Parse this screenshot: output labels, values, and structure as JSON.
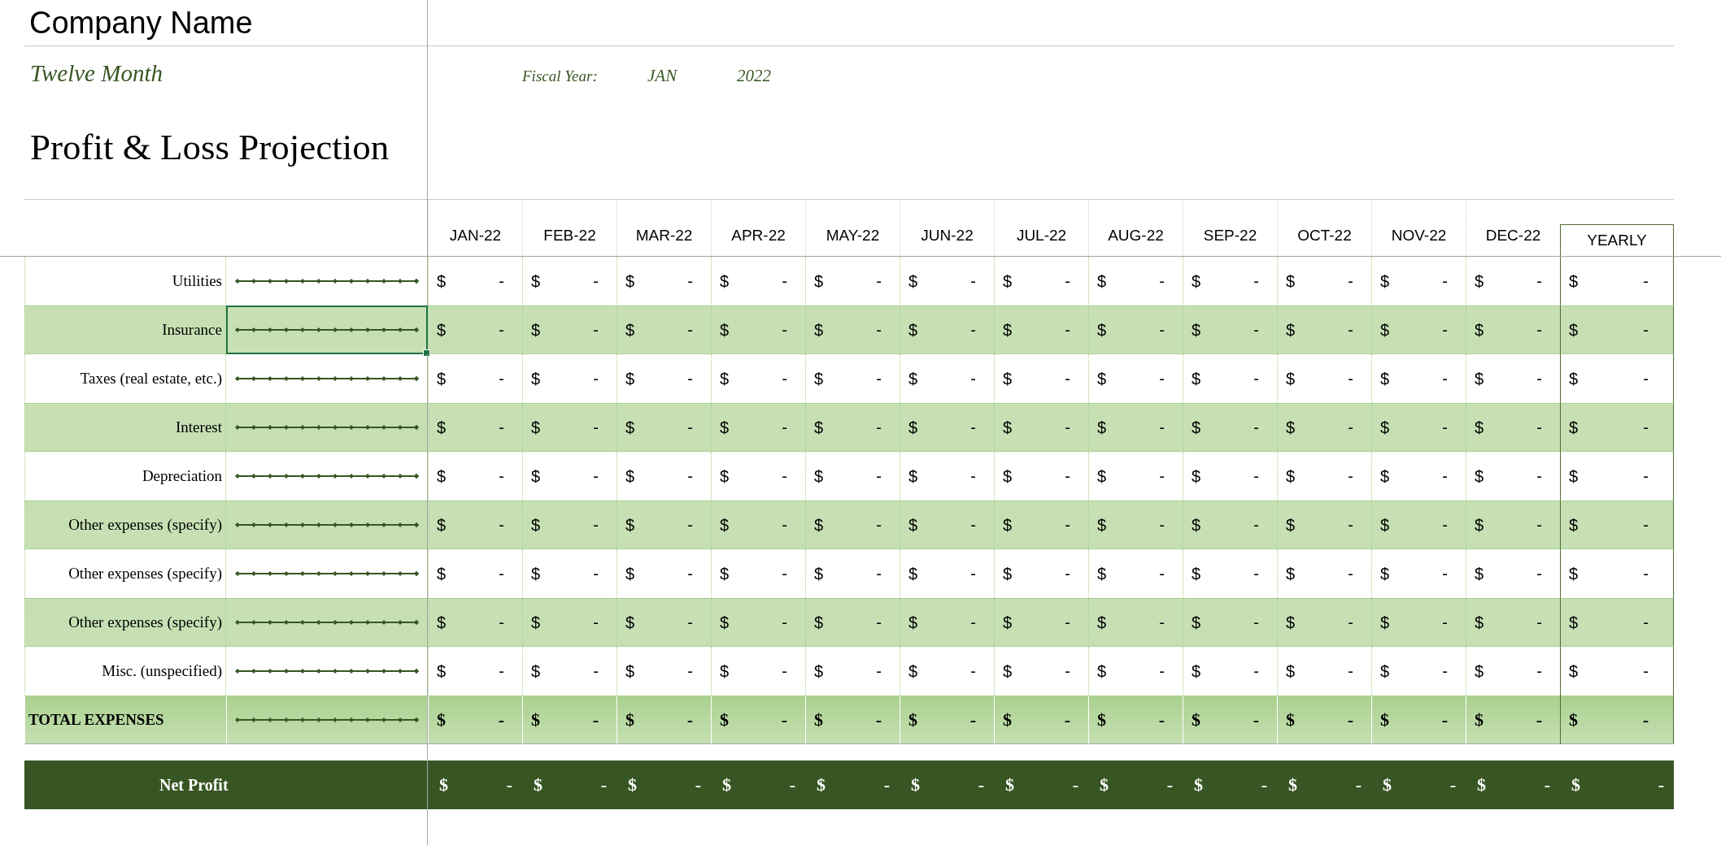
{
  "company_name": "Company Name",
  "subtitle": "Twelve Month",
  "title": "Profit & Loss Projection",
  "fiscal_year": {
    "label": "Fiscal Year:",
    "month": "JAN",
    "year": "2022"
  },
  "columns": [
    "JAN-22",
    "FEB-22",
    "MAR-22",
    "APR-22",
    "MAY-22",
    "JUN-22",
    "JUL-22",
    "AUG-22",
    "SEP-22",
    "OCT-22",
    "NOV-22",
    "DEC-22",
    "YEARLY"
  ],
  "rows": [
    {
      "kind": "item",
      "label": "Utilities",
      "sparkline_selected": false,
      "cells": [
        {
          "currency": "$",
          "amount": "-"
        },
        {
          "currency": "$",
          "amount": "-"
        },
        {
          "currency": "$",
          "amount": "-"
        },
        {
          "currency": "$",
          "amount": "-"
        },
        {
          "currency": "$",
          "amount": "-"
        },
        {
          "currency": "$",
          "amount": "-"
        },
        {
          "currency": "$",
          "amount": "-"
        },
        {
          "currency": "$",
          "amount": "-"
        },
        {
          "currency": "$",
          "amount": "-"
        },
        {
          "currency": "$",
          "amount": "-"
        },
        {
          "currency": "$",
          "amount": "-"
        },
        {
          "currency": "$",
          "amount": "-"
        },
        {
          "currency": "$",
          "amount": "-"
        }
      ]
    },
    {
      "kind": "item",
      "label": "Insurance",
      "sparkline_selected": true,
      "cells": [
        {
          "currency": "$",
          "amount": "-"
        },
        {
          "currency": "$",
          "amount": "-"
        },
        {
          "currency": "$",
          "amount": "-"
        },
        {
          "currency": "$",
          "amount": "-"
        },
        {
          "currency": "$",
          "amount": "-"
        },
        {
          "currency": "$",
          "amount": "-"
        },
        {
          "currency": "$",
          "amount": "-"
        },
        {
          "currency": "$",
          "amount": "-"
        },
        {
          "currency": "$",
          "amount": "-"
        },
        {
          "currency": "$",
          "amount": "-"
        },
        {
          "currency": "$",
          "amount": "-"
        },
        {
          "currency": "$",
          "amount": "-"
        },
        {
          "currency": "$",
          "amount": "-"
        }
      ]
    },
    {
      "kind": "item",
      "label": "Taxes (real estate, etc.)",
      "sparkline_selected": false,
      "cells": [
        {
          "currency": "$",
          "amount": "-"
        },
        {
          "currency": "$",
          "amount": "-"
        },
        {
          "currency": "$",
          "amount": "-"
        },
        {
          "currency": "$",
          "amount": "-"
        },
        {
          "currency": "$",
          "amount": "-"
        },
        {
          "currency": "$",
          "amount": "-"
        },
        {
          "currency": "$",
          "amount": "-"
        },
        {
          "currency": "$",
          "amount": "-"
        },
        {
          "currency": "$",
          "amount": "-"
        },
        {
          "currency": "$",
          "amount": "-"
        },
        {
          "currency": "$",
          "amount": "-"
        },
        {
          "currency": "$",
          "amount": "-"
        },
        {
          "currency": "$",
          "amount": "-"
        }
      ]
    },
    {
      "kind": "item",
      "label": "Interest",
      "sparkline_selected": false,
      "cells": [
        {
          "currency": "$",
          "amount": "-"
        },
        {
          "currency": "$",
          "amount": "-"
        },
        {
          "currency": "$",
          "amount": "-"
        },
        {
          "currency": "$",
          "amount": "-"
        },
        {
          "currency": "$",
          "amount": "-"
        },
        {
          "currency": "$",
          "amount": "-"
        },
        {
          "currency": "$",
          "amount": "-"
        },
        {
          "currency": "$",
          "amount": "-"
        },
        {
          "currency": "$",
          "amount": "-"
        },
        {
          "currency": "$",
          "amount": "-"
        },
        {
          "currency": "$",
          "amount": "-"
        },
        {
          "currency": "$",
          "amount": "-"
        },
        {
          "currency": "$",
          "amount": "-"
        }
      ]
    },
    {
      "kind": "item",
      "label": "Depreciation",
      "sparkline_selected": false,
      "cells": [
        {
          "currency": "$",
          "amount": "-"
        },
        {
          "currency": "$",
          "amount": "-"
        },
        {
          "currency": "$",
          "amount": "-"
        },
        {
          "currency": "$",
          "amount": "-"
        },
        {
          "currency": "$",
          "amount": "-"
        },
        {
          "currency": "$",
          "amount": "-"
        },
        {
          "currency": "$",
          "amount": "-"
        },
        {
          "currency": "$",
          "amount": "-"
        },
        {
          "currency": "$",
          "amount": "-"
        },
        {
          "currency": "$",
          "amount": "-"
        },
        {
          "currency": "$",
          "amount": "-"
        },
        {
          "currency": "$",
          "amount": "-"
        },
        {
          "currency": "$",
          "amount": "-"
        }
      ]
    },
    {
      "kind": "item",
      "label": "Other expenses (specify)",
      "sparkline_selected": false,
      "cells": [
        {
          "currency": "$",
          "amount": "-"
        },
        {
          "currency": "$",
          "amount": "-"
        },
        {
          "currency": "$",
          "amount": "-"
        },
        {
          "currency": "$",
          "amount": "-"
        },
        {
          "currency": "$",
          "amount": "-"
        },
        {
          "currency": "$",
          "amount": "-"
        },
        {
          "currency": "$",
          "amount": "-"
        },
        {
          "currency": "$",
          "amount": "-"
        },
        {
          "currency": "$",
          "amount": "-"
        },
        {
          "currency": "$",
          "amount": "-"
        },
        {
          "currency": "$",
          "amount": "-"
        },
        {
          "currency": "$",
          "amount": "-"
        },
        {
          "currency": "$",
          "amount": "-"
        }
      ]
    },
    {
      "kind": "item",
      "label": "Other expenses (specify)",
      "sparkline_selected": false,
      "cells": [
        {
          "currency": "$",
          "amount": "-"
        },
        {
          "currency": "$",
          "amount": "-"
        },
        {
          "currency": "$",
          "amount": "-"
        },
        {
          "currency": "$",
          "amount": "-"
        },
        {
          "currency": "$",
          "amount": "-"
        },
        {
          "currency": "$",
          "amount": "-"
        },
        {
          "currency": "$",
          "amount": "-"
        },
        {
          "currency": "$",
          "amount": "-"
        },
        {
          "currency": "$",
          "amount": "-"
        },
        {
          "currency": "$",
          "amount": "-"
        },
        {
          "currency": "$",
          "amount": "-"
        },
        {
          "currency": "$",
          "amount": "-"
        },
        {
          "currency": "$",
          "amount": "-"
        }
      ]
    },
    {
      "kind": "item",
      "label": "Other expenses (specify)",
      "sparkline_selected": false,
      "cells": [
        {
          "currency": "$",
          "amount": "-"
        },
        {
          "currency": "$",
          "amount": "-"
        },
        {
          "currency": "$",
          "amount": "-"
        },
        {
          "currency": "$",
          "amount": "-"
        },
        {
          "currency": "$",
          "amount": "-"
        },
        {
          "currency": "$",
          "amount": "-"
        },
        {
          "currency": "$",
          "amount": "-"
        },
        {
          "currency": "$",
          "amount": "-"
        },
        {
          "currency": "$",
          "amount": "-"
        },
        {
          "currency": "$",
          "amount": "-"
        },
        {
          "currency": "$",
          "amount": "-"
        },
        {
          "currency": "$",
          "amount": "-"
        },
        {
          "currency": "$",
          "amount": "-"
        }
      ]
    },
    {
      "kind": "item",
      "label": "Misc. (unspecified)",
      "sparkline_selected": false,
      "cells": [
        {
          "currency": "$",
          "amount": "-"
        },
        {
          "currency": "$",
          "amount": "-"
        },
        {
          "currency": "$",
          "amount": "-"
        },
        {
          "currency": "$",
          "amount": "-"
        },
        {
          "currency": "$",
          "amount": "-"
        },
        {
          "currency": "$",
          "amount": "-"
        },
        {
          "currency": "$",
          "amount": "-"
        },
        {
          "currency": "$",
          "amount": "-"
        },
        {
          "currency": "$",
          "amount": "-"
        },
        {
          "currency": "$",
          "amount": "-"
        },
        {
          "currency": "$",
          "amount": "-"
        },
        {
          "currency": "$",
          "amount": "-"
        },
        {
          "currency": "$",
          "amount": "-"
        }
      ]
    },
    {
      "kind": "total",
      "label": "TOTAL EXPENSES",
      "sparkline_selected": false,
      "cells": [
        {
          "currency": "$",
          "amount": "-"
        },
        {
          "currency": "$",
          "amount": "-"
        },
        {
          "currency": "$",
          "amount": "-"
        },
        {
          "currency": "$",
          "amount": "-"
        },
        {
          "currency": "$",
          "amount": "-"
        },
        {
          "currency": "$",
          "amount": "-"
        },
        {
          "currency": "$",
          "amount": "-"
        },
        {
          "currency": "$",
          "amount": "-"
        },
        {
          "currency": "$",
          "amount": "-"
        },
        {
          "currency": "$",
          "amount": "-"
        },
        {
          "currency": "$",
          "amount": "-"
        },
        {
          "currency": "$",
          "amount": "-"
        },
        {
          "currency": "$",
          "amount": "-"
        }
      ]
    }
  ],
  "net_profit": {
    "label": "Net Profit",
    "cells": [
      {
        "currency": "$",
        "amount": "-"
      },
      {
        "currency": "$",
        "amount": "-"
      },
      {
        "currency": "$",
        "amount": "-"
      },
      {
        "currency": "$",
        "amount": "-"
      },
      {
        "currency": "$",
        "amount": "-"
      },
      {
        "currency": "$",
        "amount": "-"
      },
      {
        "currency": "$",
        "amount": "-"
      },
      {
        "currency": "$",
        "amount": "-"
      },
      {
        "currency": "$",
        "amount": "-"
      },
      {
        "currency": "$",
        "amount": "-"
      },
      {
        "currency": "$",
        "amount": "-"
      },
      {
        "currency": "$",
        "amount": "-"
      },
      {
        "currency": "$",
        "amount": "-"
      }
    ]
  }
}
